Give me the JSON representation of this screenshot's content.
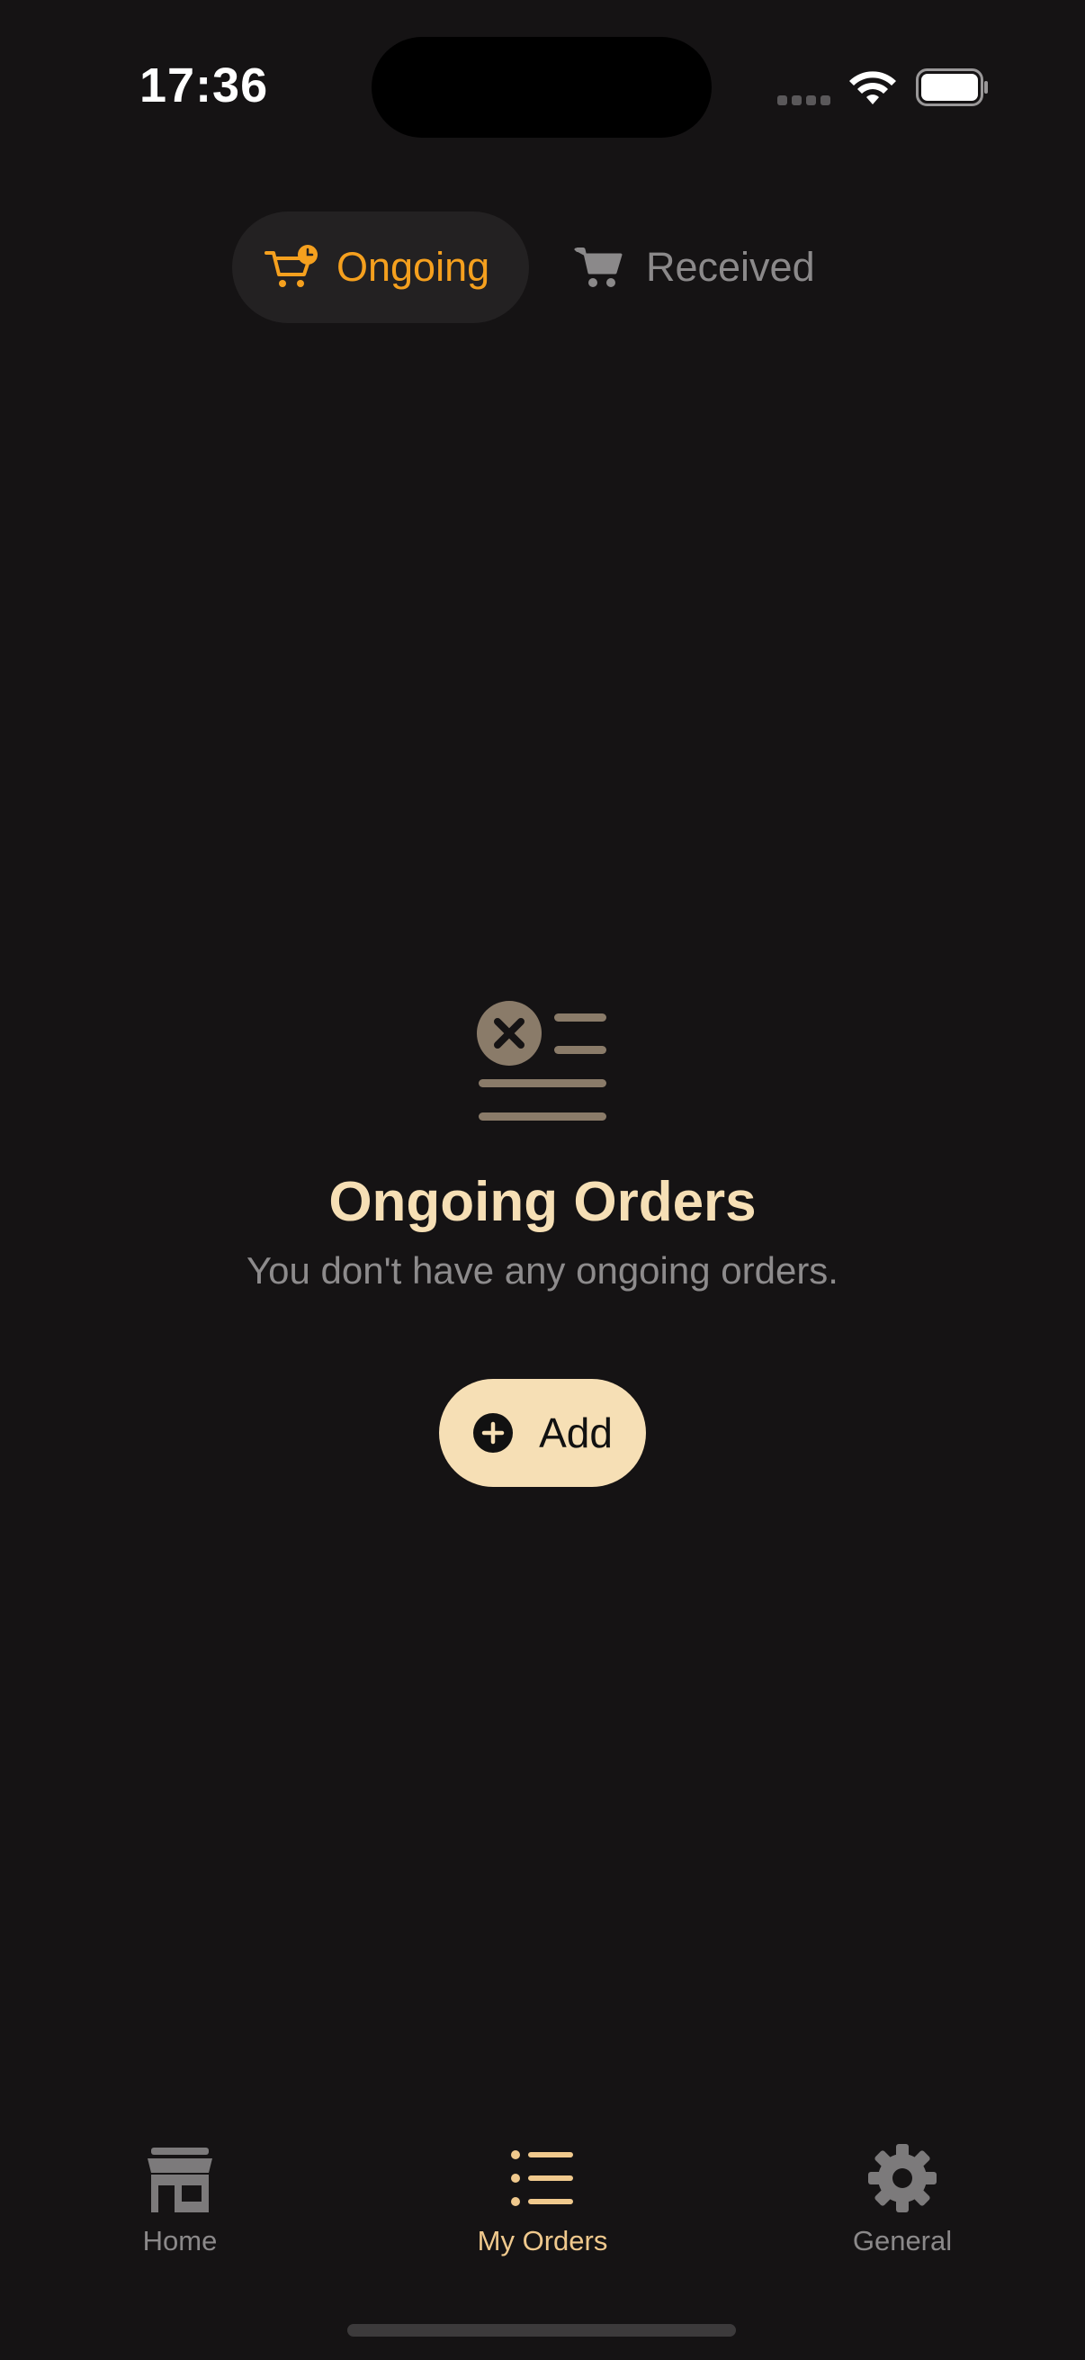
{
  "status_bar": {
    "time": "17:36"
  },
  "tabs": [
    {
      "label": "Ongoing",
      "icon": "cart-clock-icon",
      "active": true
    },
    {
      "label": "Received",
      "icon": "cart-icon",
      "active": false
    }
  ],
  "empty_state": {
    "icon": "list-x-icon",
    "title": "Ongoing Orders",
    "subtitle": "You don't have any ongoing orders.",
    "button_label": "Add"
  },
  "bottom_nav": [
    {
      "label": "Home",
      "icon": "storefront-icon",
      "active": false
    },
    {
      "label": "My Orders",
      "icon": "list-icon",
      "active": true
    },
    {
      "label": "General",
      "icon": "gear-icon",
      "active": false
    }
  ],
  "colors": {
    "background": "#151314",
    "accent_orange": "#f5a01e",
    "accent_cream": "#f6dfb5",
    "muted_text": "#8b898a"
  }
}
